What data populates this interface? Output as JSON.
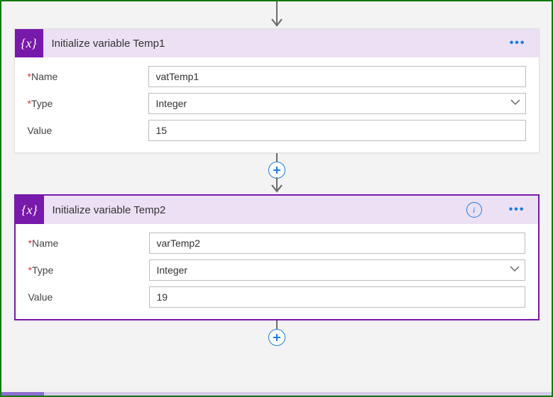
{
  "connector": {
    "top_arrow_height": 22,
    "mid_arrow_height": 14,
    "bot_arrow_height": 14
  },
  "card1": {
    "title": "Initialize variable Temp1",
    "fields": {
      "name_label": "Name",
      "type_label": "Type",
      "value_label": "Value",
      "name_value": "vatTemp1",
      "type_value": "Integer",
      "value_value": "15"
    }
  },
  "card2": {
    "title": "Initialize variable Temp2",
    "fields": {
      "name_label": "Name",
      "type_label": "Type",
      "value_label": "Value",
      "name_value": "varTemp2",
      "type_value": "Integer",
      "value_value": "19"
    }
  }
}
